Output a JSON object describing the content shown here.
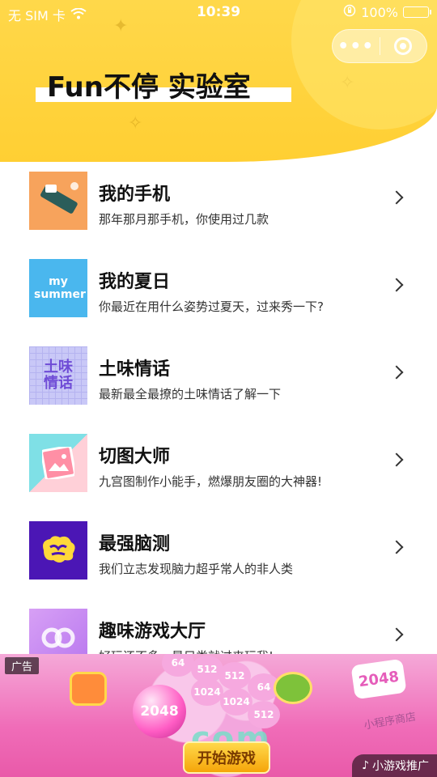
{
  "status_bar": {
    "carrier": "无 SIM 卡",
    "time": "10:39",
    "battery": "100%",
    "battery_level": 1.0
  },
  "capsule": {
    "more_label": "•••"
  },
  "header": {
    "title": "Fun不停 实验室"
  },
  "items": [
    {
      "title": "我的手机",
      "desc": "那年那月那手机，你使用过几款",
      "thumb_text": ""
    },
    {
      "title": "我的夏日",
      "desc": "你最近在用什么姿势过夏天，过来秀一下?",
      "thumb_text": "my summer"
    },
    {
      "title": "土味情话",
      "desc": "最新最全最撩的土味情话了解一下",
      "thumb_text": "土味情话"
    },
    {
      "title": "切图大师",
      "desc": "九宫图制作小能手，燃爆朋友圈的大神器!",
      "thumb_text": ""
    },
    {
      "title": "最强脑测",
      "desc": "我们立志发现脑力超乎常人的非人类",
      "thumb_text": ""
    },
    {
      "title": "趣味游戏大厅",
      "desc": "好玩还不多，最只类就过来玩我!",
      "thumb_text": ""
    }
  ],
  "ad": {
    "tag": "广告",
    "ball_text": "2048",
    "logo_text": "2048",
    "start_button": "开始游戏",
    "source_label": "小游戏推广",
    "tiles": [
      "64",
      "512",
      "512",
      "1024",
      "1024",
      "64",
      "512"
    ],
    "watermark": "com",
    "handwriting": "小程序商店"
  },
  "colors": {
    "header_yellow": "#ffd84a",
    "battery_green": "#4cd964",
    "ad_pink": "#f06cb8"
  }
}
